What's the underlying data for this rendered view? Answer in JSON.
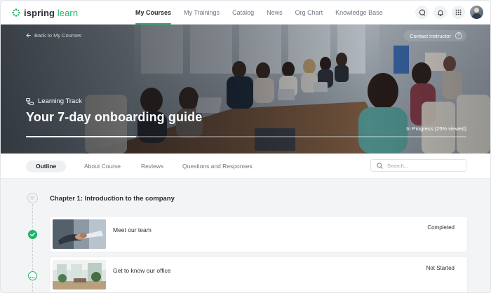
{
  "app": {
    "logo_brand": "ispring",
    "logo_product": "learn"
  },
  "nav": {
    "items": [
      {
        "label": "My Courses",
        "active": true
      },
      {
        "label": "My Trainings",
        "active": false
      },
      {
        "label": "Catalog",
        "active": false
      },
      {
        "label": "News",
        "active": false
      },
      {
        "label": "Org Chart",
        "active": false
      },
      {
        "label": "Knowledge Base",
        "active": false
      }
    ],
    "icons": [
      "chat-icon",
      "bell-icon",
      "apps-grid-icon",
      "avatar"
    ]
  },
  "hero": {
    "back_label": "Back to My Courses",
    "contact_label": "Contact instructor",
    "contact_icon": "?",
    "track_label": "Learning Track",
    "title": "Your 7-day onboarding guide",
    "progress_label": "In Progress (25% viewed)",
    "progress_fraction": 0.25
  },
  "tabs": {
    "items": [
      {
        "label": "Outline",
        "active": true
      },
      {
        "label": "About Course",
        "active": false
      },
      {
        "label": "Reviews",
        "active": false
      },
      {
        "label": "Questions and Responses",
        "active": false
      }
    ],
    "search_placeholder": "Search..."
  },
  "outline": {
    "chapter_title": "Chapter 1: Introduction to the company",
    "lessons": [
      {
        "title": "Meet our team",
        "status": "Completed",
        "state": "done"
      },
      {
        "title": "Get to know our office",
        "status": "Not Started",
        "state": "todo"
      }
    ]
  },
  "colors": {
    "accent": "#22b36b",
    "nav_active_text": "#1f2328",
    "muted_text": "#6f7680",
    "background": "#f3f4f6"
  }
}
